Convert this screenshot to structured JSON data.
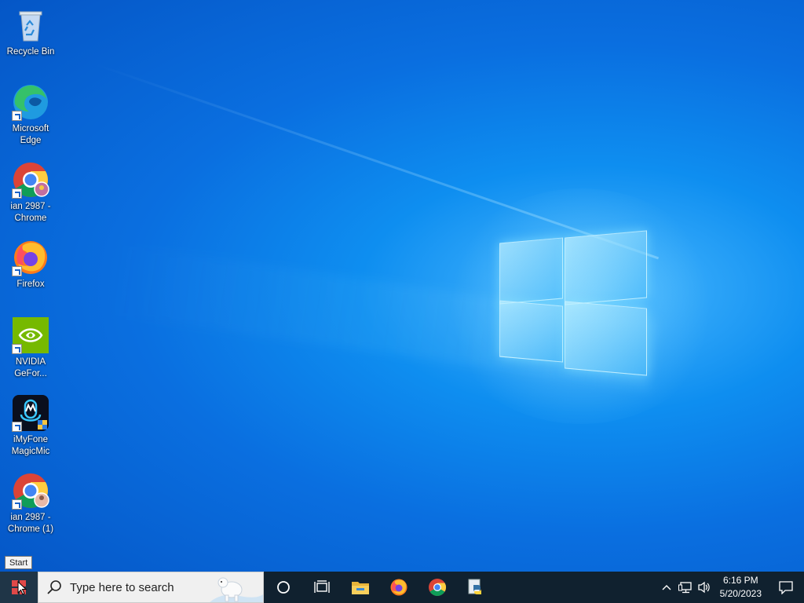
{
  "desktop": {
    "icons": [
      {
        "label": "Recycle Bin",
        "icon": "recycle-bin-icon"
      },
      {
        "label": "Microsoft Edge",
        "icon": "edge-icon"
      },
      {
        "label": "ian 2987 - Chrome",
        "icon": "chrome-icon"
      },
      {
        "label": "Firefox",
        "icon": "firefox-icon"
      },
      {
        "label": "NVIDIA GeFor...",
        "icon": "nvidia-icon"
      },
      {
        "label": "iMyFone MagicMic",
        "icon": "imyfone-magicmic-icon"
      },
      {
        "label": "ian 2987 - Chrome (1)",
        "icon": "chrome-icon"
      }
    ]
  },
  "tooltip": {
    "text": "Start"
  },
  "taskbar": {
    "search_placeholder": "Type here to search",
    "pinned": [
      "cortana-icon",
      "task-view-icon",
      "file-explorer-icon",
      "firefox-icon",
      "chrome-icon",
      "python-icon"
    ],
    "tray": [
      "chevron-up-icon",
      "network-icon",
      "volume-icon"
    ],
    "clock": {
      "time": "6:16 PM",
      "date": "5/20/2023"
    },
    "notification_icon": "notification-icon"
  },
  "colors": {
    "taskbar": "#10212f",
    "accent": "#0a78e8"
  }
}
